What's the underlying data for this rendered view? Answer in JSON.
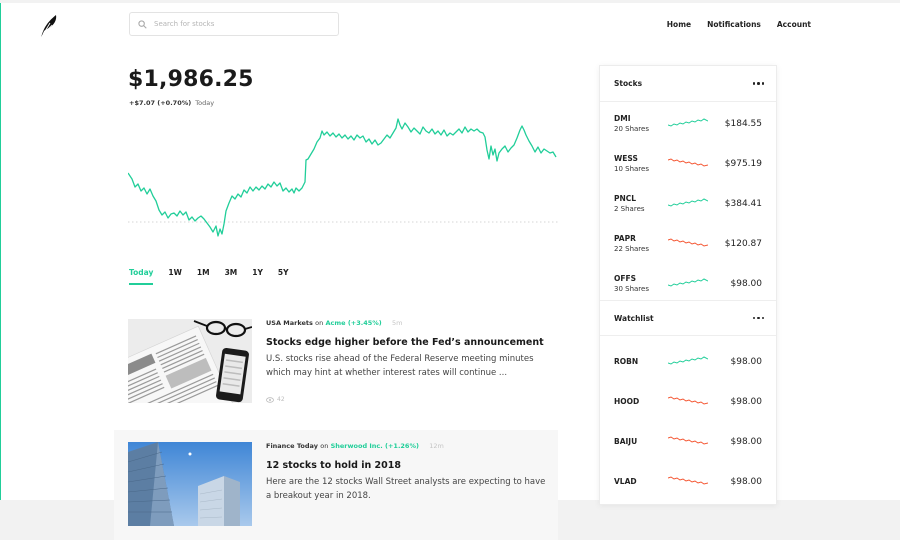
{
  "colors": {
    "accent": "#21ce99",
    "down": "#f45531"
  },
  "search": {
    "placeholder": "Search for stocks"
  },
  "nav": {
    "home": "Home",
    "notifications": "Notifications",
    "account": "Account"
  },
  "portfolio": {
    "value": "$1,986.25",
    "change": "+$7.07 (+0.70%)",
    "period": "Today"
  },
  "ranges": [
    "Today",
    "1W",
    "1M",
    "3M",
    "1Y",
    "5Y"
  ],
  "news": [
    {
      "source": "USA Markets",
      "on_label": "on",
      "ticker": "Acme (+3.45%)",
      "age": "5m",
      "title": "Stocks edge higher before the Fed’s announcement",
      "summary": "U.S. stocks rise ahead of the Federal Reserve meeting minutes which may hint at whether interest rates will continue ...",
      "views": "42",
      "image": "newspaper-phone-glasses"
    },
    {
      "source": "Finance Today",
      "on_label": "on",
      "ticker": "Sherwood Inc. (+1.26%)",
      "age": "12m",
      "title": "12 stocks to hold in 2018",
      "summary": "Here are the 12 stocks Wall Street analysts are expecting to have a breakout year in 2018.",
      "image": "skyscrapers"
    }
  ],
  "sidebar": {
    "stocks_label": "Stocks",
    "watchlist_label": "Watchlist",
    "stocks": [
      {
        "symbol": "DMI",
        "shares": "20 Shares",
        "price": "$184.55",
        "trend": "up"
      },
      {
        "symbol": "WESS",
        "shares": "10 Shares",
        "price": "$975.19",
        "trend": "down"
      },
      {
        "symbol": "PNCL",
        "shares": "2 Shares",
        "price": "$384.41",
        "trend": "up"
      },
      {
        "symbol": "PAPR",
        "shares": "22 Shares",
        "price": "$120.87",
        "trend": "down"
      },
      {
        "symbol": "OFFS",
        "shares": "30 Shares",
        "price": "$98.00",
        "trend": "up"
      }
    ],
    "watchlist": [
      {
        "symbol": "ROBN",
        "price": "$98.00",
        "trend": "up"
      },
      {
        "symbol": "HOOD",
        "price": "$98.00",
        "trend": "down"
      },
      {
        "symbol": "BAIJU",
        "price": "$98.00",
        "trend": "down"
      },
      {
        "symbol": "VLAD",
        "price": "$98.00",
        "trend": "down"
      }
    ]
  }
}
